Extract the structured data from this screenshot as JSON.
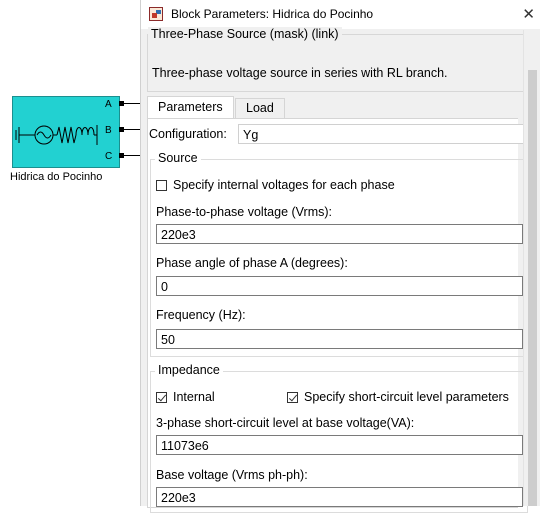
{
  "block": {
    "name": "Hidrica do Pocinho",
    "ports": [
      "A",
      "B",
      "C"
    ],
    "color": "#22d1d1"
  },
  "dialog": {
    "title": "Block Parameters: Hidrica do Pocinho",
    "close_glyph": "✕",
    "mask_caption": "Three-Phase Source (mask) (link)",
    "mask_description": "Three-phase voltage source in series with RL branch.",
    "tabs": [
      "Parameters",
      "Load Flow"
    ],
    "active_tab": "Parameters",
    "configuration": {
      "label": "Configuration:",
      "value": "Yg"
    },
    "source": {
      "caption": "Source",
      "specify_internal": {
        "label": "Specify internal voltages for each phase",
        "checked": false
      },
      "fields": [
        {
          "label": "Phase-to-phase voltage (Vrms):",
          "value": "220e3"
        },
        {
          "label": "Phase angle of phase A (degrees):",
          "value": "0"
        },
        {
          "label": "Frequency (Hz):",
          "value": "50"
        }
      ]
    },
    "impedance": {
      "caption": "Impedance",
      "internal": {
        "label": "Internal",
        "checked": true
      },
      "short_circuit": {
        "label": "Specify short-circuit level parameters",
        "checked": true
      },
      "fields": [
        {
          "label": "3-phase short-circuit level at base voltage(VA):",
          "value": "11073e6"
        },
        {
          "label": "Base voltage (Vrms ph-ph):",
          "value": "220e3"
        }
      ]
    }
  }
}
